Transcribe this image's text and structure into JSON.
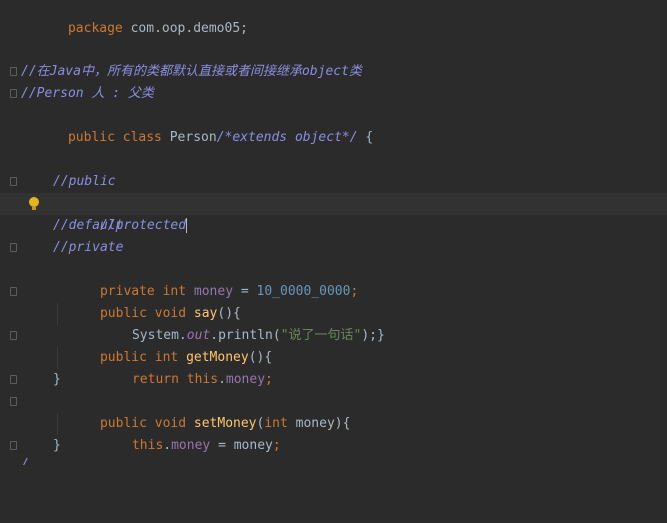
{
  "code": {
    "package_kw": "package",
    "package_name": " com.oop.demo05;",
    "comment1": "//在Java中，所有的类都默认直接或者间接继承object类",
    "comment2": "//Person 人 : 父类",
    "class_kw": "public class",
    "class_name": " Person",
    "extends_comment": "/*extends object*/",
    "class_open": " {",
    "c_public": "//public",
    "c_protected": "//protected",
    "c_default": "//default",
    "c_private": "//private",
    "field_mods": "private int",
    "field_name": " money",
    "field_assign": " = ",
    "field_value": "10_0000_0000",
    "field_end": ";",
    "say_mods": "public void",
    "say_name": " say",
    "say_parens": "(){",
    "sys": "System.",
    "out": "out",
    "println": ".println(",
    "say_str": "\"说了一句话\"",
    "say_end": ");}",
    "getm_mods": "public int",
    "getm_name": " getMoney",
    "getm_parens": "(){",
    "return_kw": "return",
    "this_kw": " this",
    "dot": ".",
    "money_ref": "money",
    "semi": ";",
    "close_brace": "}",
    "setm_mods": "public void",
    "setm_name": " setMoney",
    "setm_open": "(",
    "setm_param_type": "int",
    "setm_param": " money){",
    "this_kw2": "this",
    "assign_rhs": " = money",
    "last_line": "/"
  }
}
